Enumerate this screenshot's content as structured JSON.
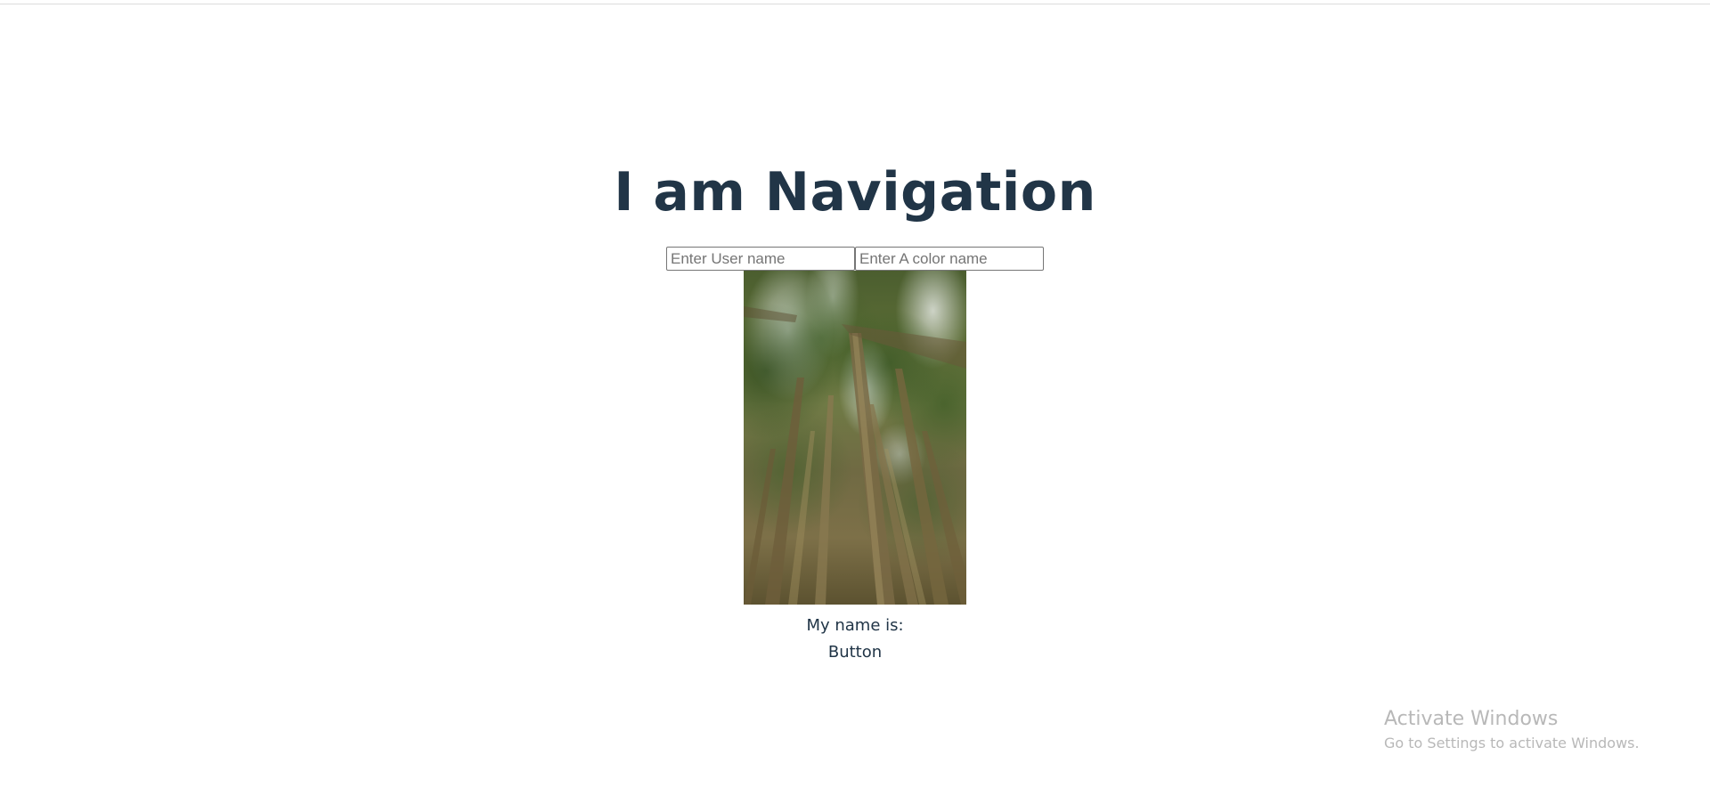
{
  "page": {
    "title": "I am Navigation"
  },
  "form": {
    "username_placeholder": "Enter User name",
    "username_value": "",
    "color_placeholder": "Enter A color name",
    "color_value": ""
  },
  "image": {
    "alt": "Tall trees viewed from below"
  },
  "name_display": {
    "label": "My name is:"
  },
  "button": {
    "label": "Button"
  },
  "watermark": {
    "title": "Activate Windows",
    "subtitle": "Go to Settings to activate Windows."
  },
  "colors": {
    "heading": "#213547",
    "background": "#ffffff"
  }
}
